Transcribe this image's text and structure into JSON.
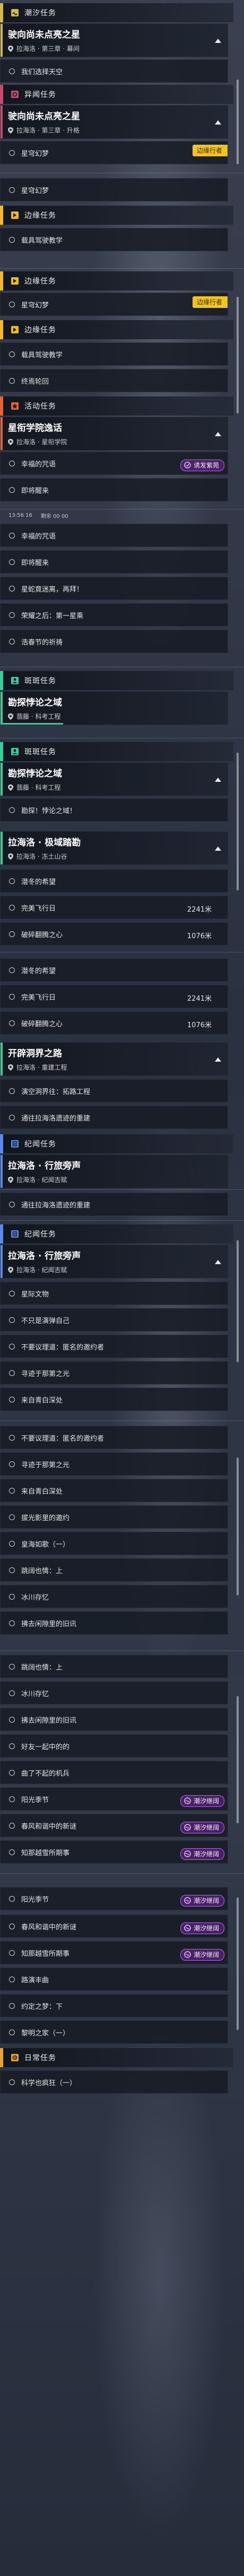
{
  "sections": {
    "chaoxi_1": "潮汐任务",
    "yiwen_1": "异闻任务",
    "bianyuan_1": "边缘任务",
    "bianyuan_2": "边缘任务",
    "bianyuan_3": "边缘任务",
    "huodong": "活动任务",
    "bianyuan_4": "边缘任务",
    "banban_1": "斑斑任务",
    "banban_2": "斑斑任务",
    "jiyu_1": "纪闻任务",
    "jiyu_2": "纪闻任务",
    "richang": "日常任务"
  },
  "cards": {
    "c1": {
      "title": "驶向尚未点亮之星",
      "subtitle": "拉海洛 · 第三章 · 幕间"
    },
    "c2": {
      "title": "驶向尚未点亮之星",
      "subtitle": "拉海洛 · 第三章 · 升格"
    },
    "c3": {
      "title": "星衔学院逸话",
      "subtitle": "拉海洛 · 星衔学院"
    },
    "c4": {
      "title": "勘探悖论之域",
      "subtitle": "翡藤 · 科考工程"
    },
    "c5": {
      "title": "勘探悖论之域",
      "subtitle": "翡藤 · 科考工程"
    },
    "c6": {
      "title": "拉海洛 · 极域踏勘",
      "subtitle": "拉海洛 · 冻土山谷"
    },
    "c7": {
      "title": "开辟洞界之路",
      "subtitle": "拉海洛 · 重建工程"
    },
    "c8": {
      "title": "拉海洛 · 行旅旁声",
      "subtitle": "拉海洛 · 纪闻吉赋"
    },
    "c9": {
      "title": "拉海洛 · 行旅旁声",
      "subtitle": "拉海洛 · 纪闻吉赋"
    }
  },
  "tasks": {
    "t1": "我们选择天空",
    "t2": "星穹幻梦",
    "t3": "星穹幻梦",
    "t4": "载具驾驶教学",
    "t5": "载具驾驶教学",
    "t6": "终焉轮回",
    "t7": "幸福的咒语",
    "t8": "即将醒来",
    "t9": "幸福的咒语",
    "t10": "即将醒来",
    "t11": "星蛇竟迷离，再拜！",
    "t12": "荣耀之后：第一星乘",
    "t13": "浩春节的祈祷",
    "t14": "勘探！悖论之域！",
    "t15": "潜冬的希望",
    "t16": "完美飞行日",
    "t17": "破碎翻腾之心",
    "t18": "潜冬的希望",
    "t19": "完美飞行日",
    "t20": "破碎翻腾之心",
    "t21": "演空洞界往：拓路工程",
    "t22": "通往拉海洛遗迹的重建",
    "t23": "通往拉海洛遗迹的重建",
    "t24": "星际文物",
    "t25": "不只是演弹自己",
    "t26": "不要议理道：匿名的邀约者",
    "t27": "寻迹于那第之光",
    "t28": "来自青白深处",
    "t29": "不要议理道：匿名的邀约者",
    "t30": "寻迹于那第之光",
    "t31": "来自青白深处",
    "t32": "拔光影里的邀约",
    "t33": "皇海如歌（一）",
    "t34": "跳阔也情：上",
    "t35": "冰川存忆",
    "t36": "拂去闲隙里的旧讯",
    "t37": "跳阔也情：上",
    "t38": "冰川存忆",
    "t39": "拂去闲隙里的旧讯",
    "t40": "好友一起中的的",
    "t41": "曲了不起的机兵",
    "t42": "阳光季节",
    "t43": "春风和谐中的新谜",
    "t44": "知那越雪所期事",
    "t45": "阳光季节",
    "t46": "春风和谐中的新谜",
    "t47": "知那越雪所期事",
    "t48": "路演丰曲",
    "t49": "约定之梦：下",
    "t50": "黎明之家（一）",
    "t51": "科学也疯狂（一）"
  },
  "task_values": {
    "v1": "2241米",
    "v2": "1076米",
    "v3": "2241米",
    "v4": "1076米"
  },
  "tags": {
    "edge_walker_1": "边缘行者",
    "edge_walker_2": "边缘行者"
  },
  "pills": {
    "p1": "诱发紫苑",
    "p2": "潮汐继阔",
    "p3": "潮汐继阔",
    "p4": "潮汐继阔",
    "p5": "潮汐继阔",
    "p6": "潮汐继阔",
    "p7": "潮汐继阔"
  },
  "status_bar": {
    "time": "13:56 16",
    "info": "剩余 00 00"
  },
  "colors": {
    "chaoxi": "#d7b64a",
    "yiwen": "#c84a6a",
    "bianyuan": "#f0b92a",
    "huodong": "#e8613f",
    "banban": "#3ccb9a",
    "jiyu": "#5a8ae6",
    "richang": "#e3a23a",
    "pill_purple": "#b66cf2",
    "tag_yellow": "#f3c41e"
  }
}
